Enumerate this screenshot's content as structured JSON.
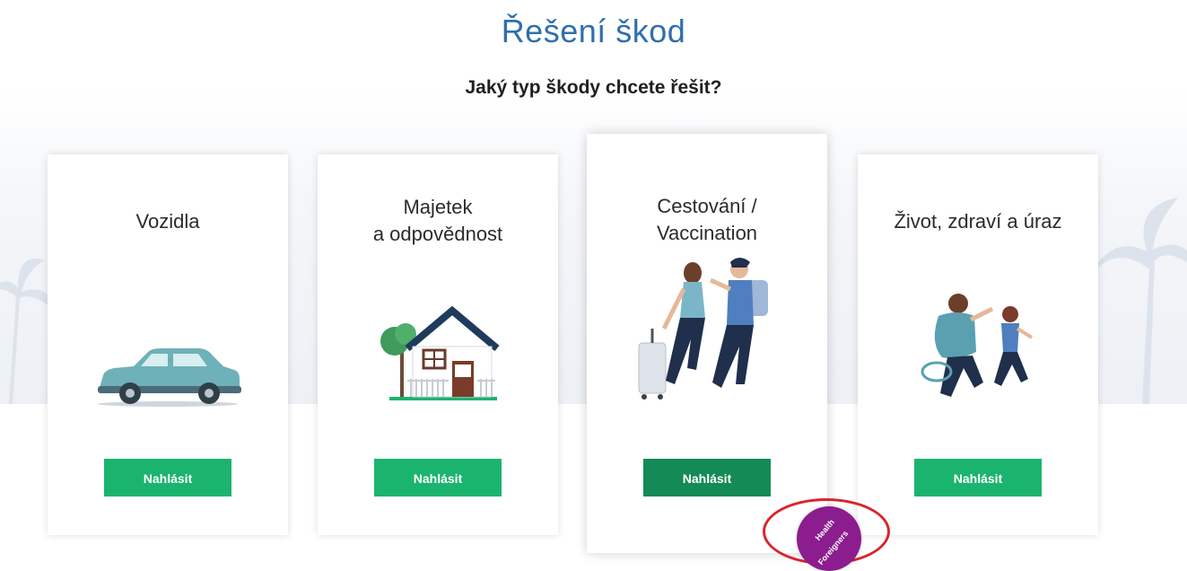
{
  "page": {
    "title": "Řešení škod",
    "question": "Jaký typ škody chcete řešit?"
  },
  "cards": [
    {
      "title": "Vozidla",
      "button_label": "Nahlásit",
      "illustration": "car-illustration"
    },
    {
      "title_line1": "Majetek",
      "title_line2": "a odpovědnost",
      "button_label": "Nahlásit",
      "illustration": "house-illustration"
    },
    {
      "title_line1": "Cestování /",
      "title_line2": "Vaccination",
      "button_label": "Nahlásit",
      "illustration": "travelers-illustration"
    },
    {
      "title": "Život, zdraví a úraz",
      "button_label": "Nahlásit",
      "illustration": "family-illustration"
    }
  ],
  "badge": {
    "line1": "Health",
    "line2": "Foreigners"
  },
  "colors": {
    "title": "#2f6fab",
    "button": "#1bb46e",
    "button_active": "#148a56",
    "badge": "#8b1d8e",
    "highlight_ring": "#d9252b"
  }
}
